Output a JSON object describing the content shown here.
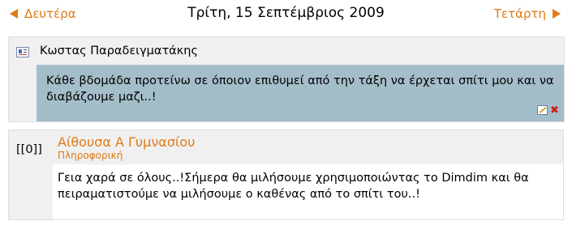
{
  "nav": {
    "prev_label": "Δευτέρα",
    "next_label": "Τετάρτη",
    "date_label": "Τρίτη, 15 Σεπτέμβριος 2009"
  },
  "entry_user": {
    "icon": "user-entry-icon",
    "author_name": "Κωστας Παραδειγματάκης",
    "message": "Κάθε βδομάδα προτείνω σε όποιον επιθυμεί από την τάξη να έρχεται σπίτι μου και να διαβάζουμε μαζι..!",
    "actions": {
      "edit_icon": "edit-icon",
      "delete_icon": "delete-icon"
    }
  },
  "entry_course": {
    "tag": "[[0]]",
    "title": "Αίθουσα Α Γυμνασίου",
    "subtitle": "Πληροφορική",
    "message": "Γεια χαρά σε όλους..!Σήμερα θα μιλήσουμε χρησιμοποιώντας το Dimdim και θα πειραματιστούμε να μιλήσουμε ο καθένας από το σπίτι του..!"
  },
  "colors": {
    "link": "#e07a16",
    "highlight_bg": "#a4bec9",
    "panel_bg": "#f0f0f0"
  }
}
